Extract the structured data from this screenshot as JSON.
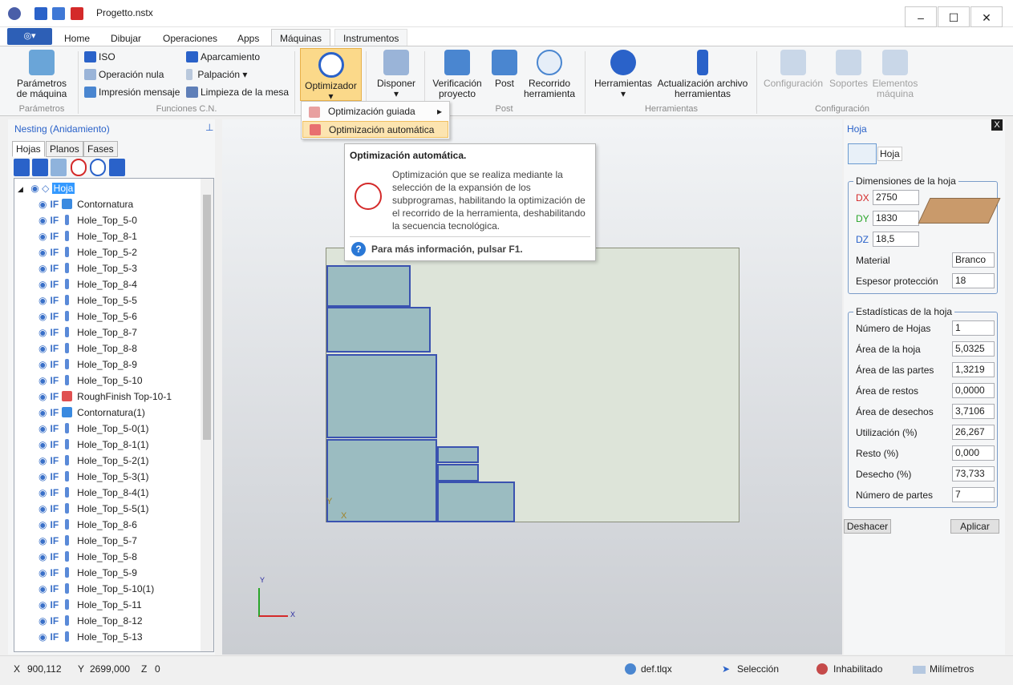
{
  "app": {
    "title": "Progetto.nstx"
  },
  "titlebar": {
    "minimize": "–",
    "maximize": "☐",
    "close": "✕"
  },
  "ribbon": {
    "appmenu": "◎▾",
    "tabs": [
      "Home",
      "Dibujar",
      "Operaciones",
      "Apps",
      "Máquinas",
      "Instrumentos"
    ],
    "active_tab": "Máquinas",
    "groups": {
      "parametros": {
        "label": "Parámetros",
        "btn": [
          "Parámetros",
          "de máquina"
        ]
      },
      "funciones": {
        "label": "Funciones C.N.",
        "iso": "ISO",
        "operacion_nula": "Operación nula",
        "impresion": "Impresión mensaje",
        "aparcamiento": "Aparcamiento",
        "palpacion": "Palpación",
        "palpacion_arrow": "▾",
        "limpieza": "Limpieza de la mesa"
      },
      "optimizador": {
        "label": "Optimizador",
        "arrow": "▾"
      },
      "disponer": {
        "label": "Disponer",
        "arrow": "▾"
      },
      "post": {
        "label": "Post",
        "verificacion": [
          "Verificación",
          "proyecto"
        ],
        "post_btn": "Post",
        "recorrido": [
          "Recorrido",
          "herramienta"
        ]
      },
      "herramientas": {
        "label": "Herramientas",
        "herramientas_btn": "Herramientas",
        "arrow": "▾",
        "actualizacion": [
          "Actualización archivo",
          "herramientas"
        ]
      },
      "configuracion": {
        "label": "Configuración",
        "config_btn": "Configuración",
        "soportes": "Soportes",
        "elementos": [
          "Elementos",
          "máquina"
        ]
      }
    }
  },
  "dropdown": {
    "items": [
      {
        "label": "Optimización guiada",
        "arrow": "▸"
      },
      {
        "label": "Optimización automática"
      }
    ]
  },
  "tooltip": {
    "title": "Optimización automática.",
    "body": [
      "Optimización que se realiza mediante la",
      "selección de la expansión de los",
      "subprogramas, habilitando la optimización de",
      "el recorrido de la herramienta, deshabilitando",
      "la secuencia tecnológica."
    ],
    "help": "Para más información, pulsar F1."
  },
  "left_panel": {
    "title": "Nesting (Anidamiento)",
    "pin": "⊥",
    "tabs": [
      "Hojas",
      "Planos",
      "Fases"
    ],
    "root": "Hoja",
    "items": [
      {
        "name": "Contornatura",
        "icon": "contour"
      },
      {
        "name": "Hole_Top_5-0",
        "icon": "drill"
      },
      {
        "name": "Hole_Top_8-1",
        "icon": "drill"
      },
      {
        "name": "Hole_Top_5-2",
        "icon": "drill"
      },
      {
        "name": "Hole_Top_5-3",
        "icon": "drill"
      },
      {
        "name": "Hole_Top_8-4",
        "icon": "drill"
      },
      {
        "name": "Hole_Top_5-5",
        "icon": "drill"
      },
      {
        "name": "Hole_Top_5-6",
        "icon": "drill"
      },
      {
        "name": "Hole_Top_8-7",
        "icon": "drill"
      },
      {
        "name": "Hole_Top_8-8",
        "icon": "drill"
      },
      {
        "name": "Hole_Top_8-9",
        "icon": "drill"
      },
      {
        "name": "Hole_Top_5-10",
        "icon": "drill"
      },
      {
        "name": "RoughFinish Top-10-1",
        "icon": "rough"
      },
      {
        "name": "Contornatura(1)",
        "icon": "contour"
      },
      {
        "name": "Hole_Top_5-0(1)",
        "icon": "drill"
      },
      {
        "name": "Hole_Top_8-1(1)",
        "icon": "drill"
      },
      {
        "name": "Hole_Top_5-2(1)",
        "icon": "drill"
      },
      {
        "name": "Hole_Top_5-3(1)",
        "icon": "drill"
      },
      {
        "name": "Hole_Top_8-4(1)",
        "icon": "drill"
      },
      {
        "name": "Hole_Top_5-5(1)",
        "icon": "drill"
      },
      {
        "name": "Hole_Top_8-6",
        "icon": "drill"
      },
      {
        "name": "Hole_Top_5-7",
        "icon": "drill"
      },
      {
        "name": "Hole_Top_5-8",
        "icon": "drill"
      },
      {
        "name": "Hole_Top_5-9",
        "icon": "drill"
      },
      {
        "name": "Hole_Top_5-10(1)",
        "icon": "drill"
      },
      {
        "name": "Hole_Top_5-11",
        "icon": "drill"
      },
      {
        "name": "Hole_Top_8-12",
        "icon": "drill"
      },
      {
        "name": "Hole_Top_5-13",
        "icon": "drill"
      }
    ],
    "if_label": "IF"
  },
  "canvas": {
    "axis_y": "Y",
    "axis_x": "X",
    "sheet_y": "Y",
    "sheet_x": "X"
  },
  "right_panel": {
    "title": "Hoja",
    "close": "X",
    "hoja_label": "Hoja",
    "dimensions": {
      "legend": "Dimensiones de la hoja",
      "dx_label": "DX",
      "dx": "2750",
      "dy_label": "DY",
      "dy": "1830",
      "dz_label": "DZ",
      "dz": "18,5",
      "material_label": "Material",
      "material": "Branco",
      "espesor_label": "Espesor protección",
      "espesor": "18"
    },
    "stats": {
      "legend": "Estadísticas de la hoja",
      "rows": [
        {
          "label": "Número de Hojas",
          "value": "1"
        },
        {
          "label": "Área de la hoja",
          "value": "5,0325"
        },
        {
          "label": "Área de las partes",
          "value": "1,3219"
        },
        {
          "label": "Área de restos",
          "value": "0,0000"
        },
        {
          "label": "Área de desechos",
          "value": "3,7106"
        },
        {
          "label": "Utilización (%)",
          "value": "26,267"
        },
        {
          "label": "Resto (%)",
          "value": "0,000"
        },
        {
          "label": "Desecho (%)",
          "value": "73,733"
        },
        {
          "label": "Número de partes",
          "value": "7"
        }
      ]
    },
    "deshacer": "Deshacer",
    "aplicar": "Aplicar"
  },
  "statusbar": {
    "x_label": "X",
    "x": "900,112",
    "y_label": "Y",
    "y": "2699,000",
    "z_label": "Z",
    "z": "0",
    "file": "def.tlqx",
    "mode": "Selección",
    "state": "Inhabilitado",
    "units": "Milímetros"
  },
  "colors": {
    "accent": "#2d5fb6",
    "sheet": "#dde4d9",
    "part": "#9bbcc1",
    "part_border": "#3a52b0"
  }
}
